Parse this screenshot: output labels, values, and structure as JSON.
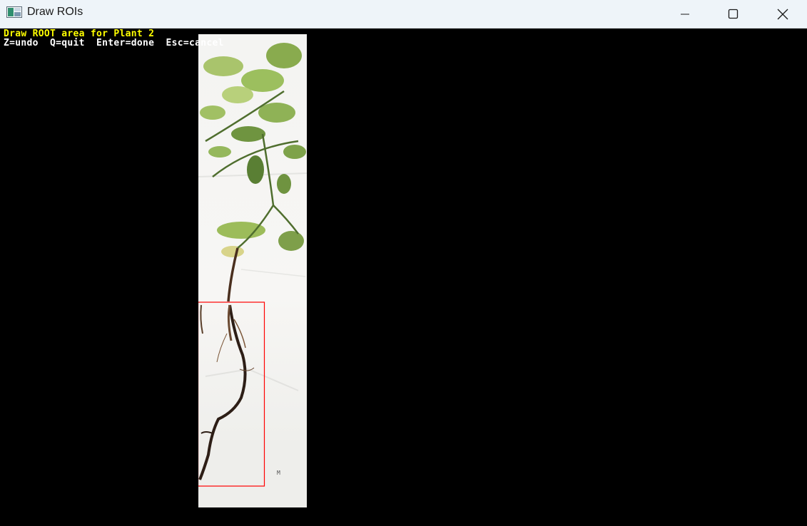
{
  "window": {
    "title": "Draw ROIs",
    "controls": {
      "minimize": "minimize-icon",
      "maximize": "maximize-icon",
      "close": "close-icon"
    }
  },
  "overlay": {
    "instruction": "Draw ROOT area for Plant 2",
    "shortcuts": "Z=undo  Q=quit  Enter=done  Esc=cancel",
    "instruction_color": "#ffff00",
    "shortcuts_color": "#ffffff"
  },
  "roi": {
    "color": "#ff0000"
  }
}
